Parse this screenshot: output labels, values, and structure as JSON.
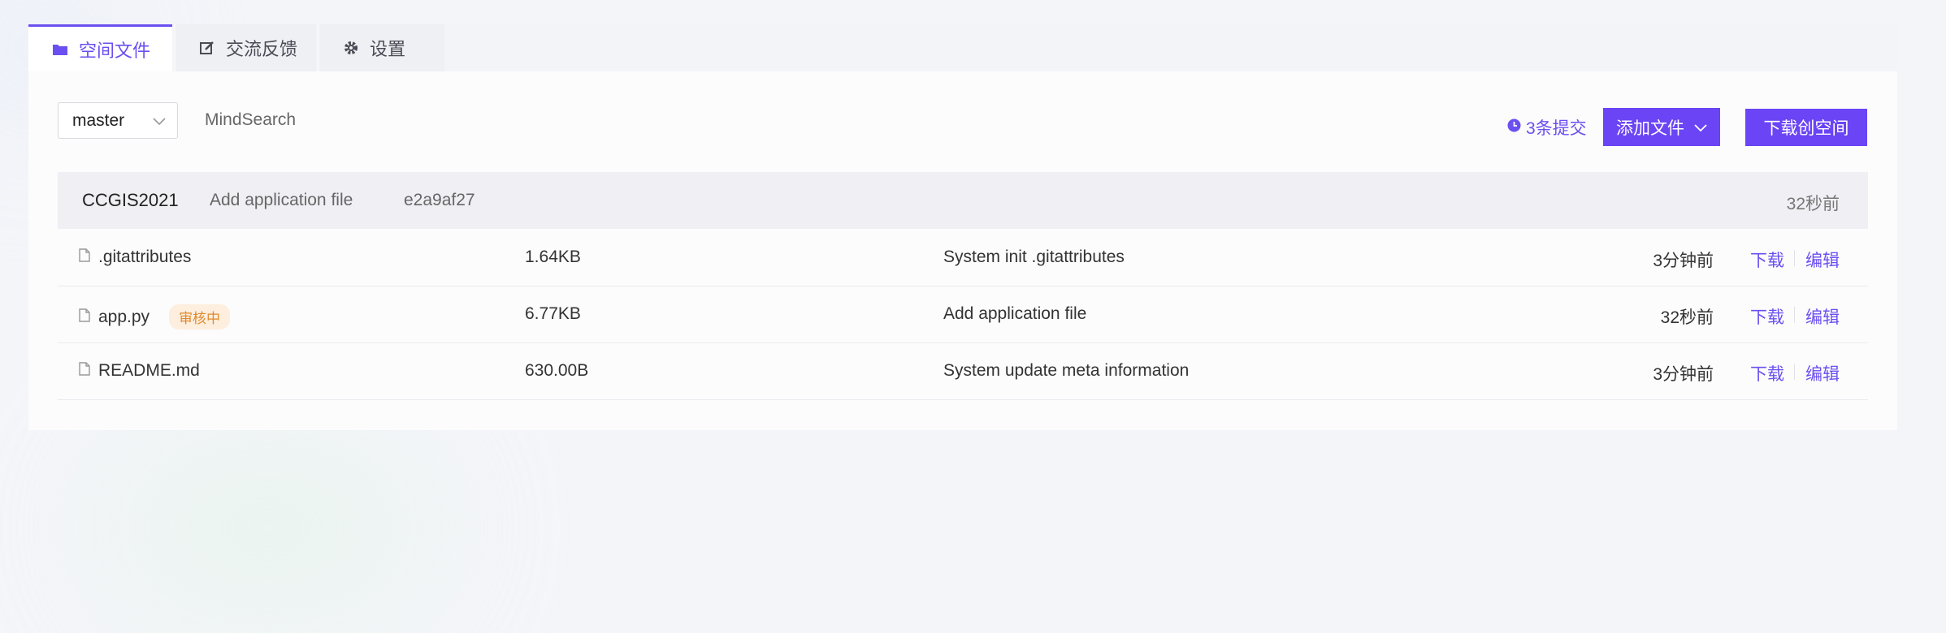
{
  "tabs": [
    {
      "label": "空间文件",
      "icon": "folder-icon",
      "active": true
    },
    {
      "label": "交流反馈",
      "icon": "edit-icon",
      "active": false
    },
    {
      "label": "设置",
      "icon": "gear-icon",
      "active": false
    }
  ],
  "branch": {
    "selected": "master"
  },
  "repo": {
    "name": "MindSearch"
  },
  "toolbar": {
    "commits_label": "3条提交",
    "add_file_label": "添加文件",
    "download_label": "下载创空间"
  },
  "latest_commit": {
    "author": "CCGIS2021",
    "message": "Add application file",
    "hash": "e2a9af27",
    "time": "32秒前"
  },
  "files": [
    {
      "name": ".gitattributes",
      "badge": "",
      "size": "1.64KB",
      "message": "System init .gitattributes",
      "time": "3分钟前",
      "download": "下载",
      "edit": "编辑"
    },
    {
      "name": "app.py",
      "badge": "审核中",
      "size": "6.77KB",
      "message": "Add application file",
      "time": "32秒前",
      "download": "下载",
      "edit": "编辑"
    },
    {
      "name": "README.md",
      "badge": "",
      "size": "630.00B",
      "message": "System update meta information",
      "time": "3分钟前",
      "download": "下载",
      "edit": "编辑"
    }
  ],
  "colors": {
    "accent": "#6a44f5",
    "badge_bg": "#fdeede",
    "badge_text": "#e08a2e"
  }
}
